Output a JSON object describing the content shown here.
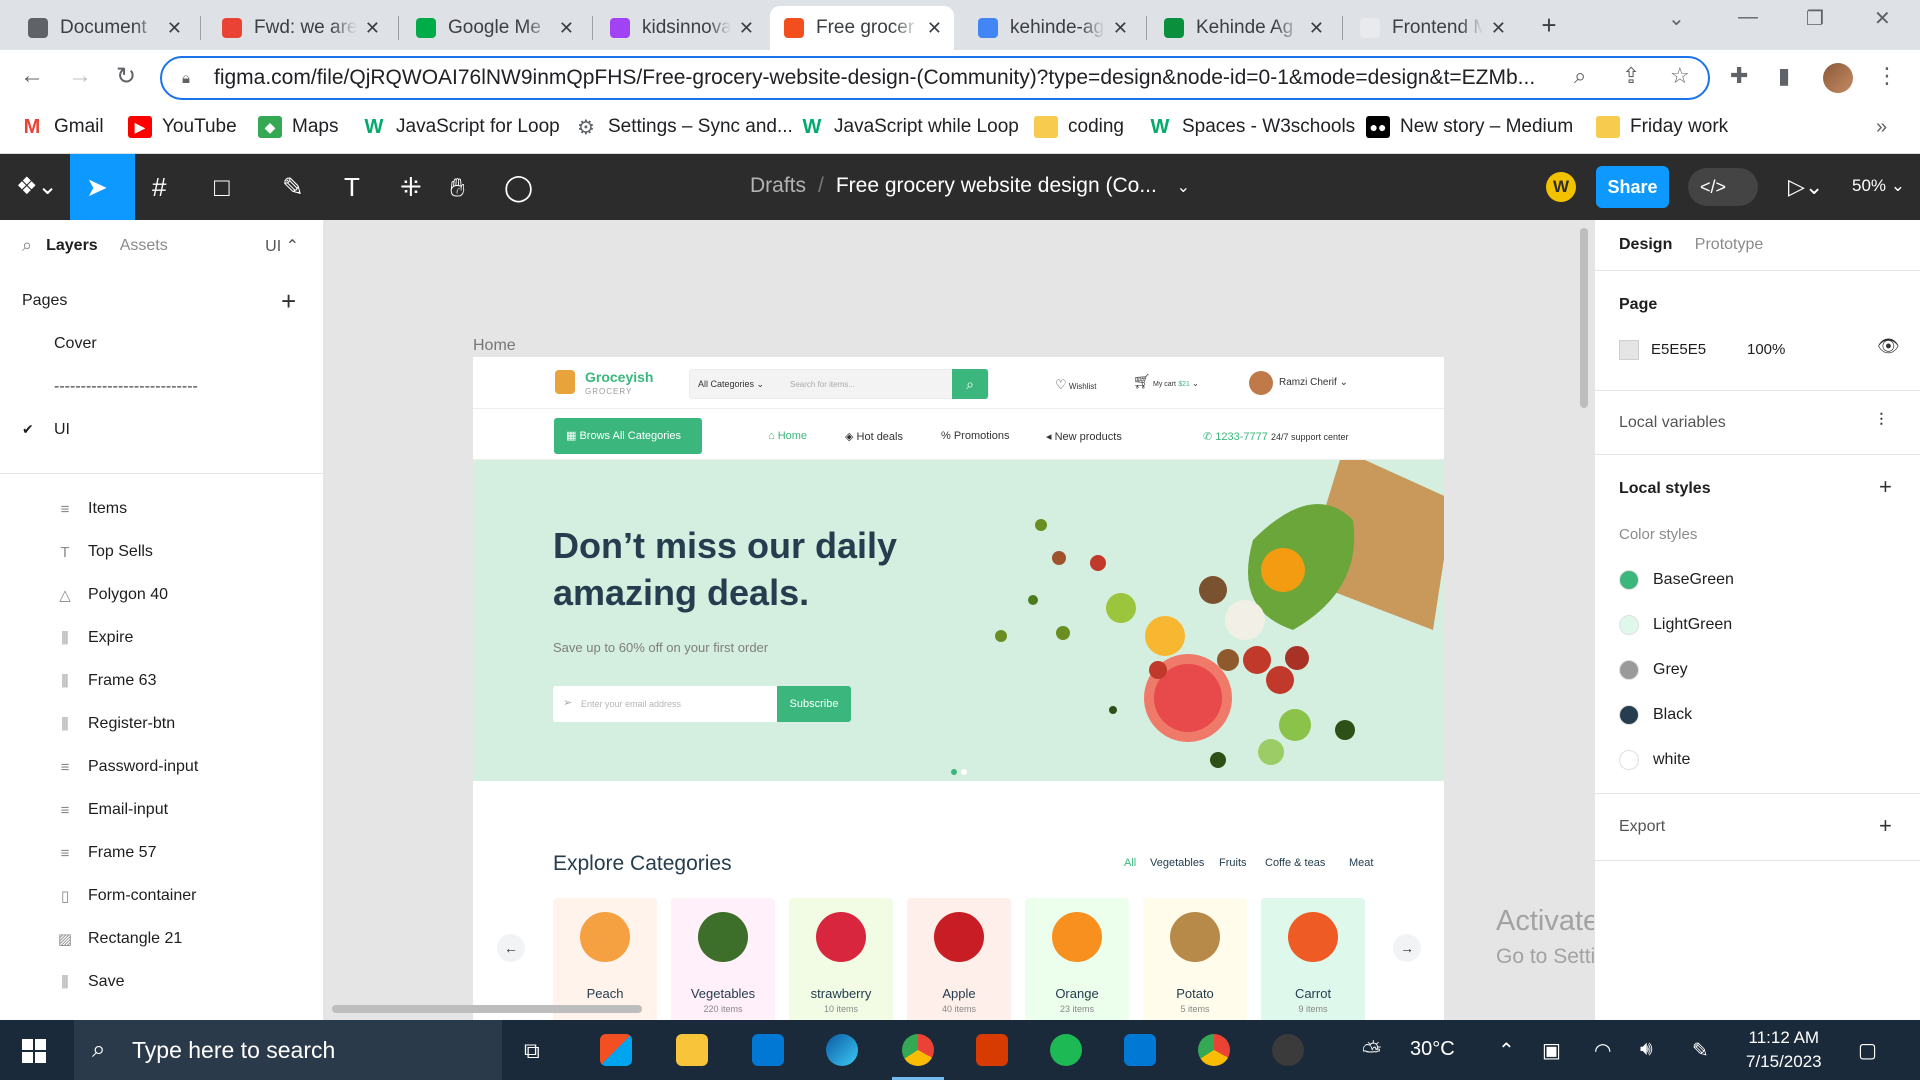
{
  "browser": {
    "tabs": [
      {
        "title": "Document",
        "color": "#5f6368"
      },
      {
        "title": "Fwd: we are",
        "color": "#ea4335"
      },
      {
        "title": "Google Me",
        "color": "#00ac47"
      },
      {
        "title": "kidsinnovat",
        "color": "#a142f4"
      },
      {
        "title": "Free grocer",
        "color": "#f24e1e"
      },
      {
        "title": "kehinde-ag",
        "color": "#4285f4"
      },
      {
        "title": "Kehinde Ag",
        "color": "#0a8f3d"
      },
      {
        "title": "Frontend M",
        "color": "#e8eaed"
      }
    ],
    "url": "figma.com/file/QjRQWOAI76lNW9inmQpFHS/Free-grocery-website-design-(Community)?type=design&node-id=0-1&mode=design&t=EZMb...",
    "bookmarks": [
      "Gmail",
      "YouTube",
      "Maps",
      "JavaScript for Loop",
      "Settings – Sync and...",
      "JavaScript while Loop",
      "coding",
      "Spaces - W3schools",
      "New story – Medium",
      "Friday work"
    ]
  },
  "figma": {
    "breadcrumb_drafts": "Drafts",
    "breadcrumb_sep": "/",
    "file_name": "Free grocery website design (Co...",
    "user_initial": "W",
    "share_label": "Share",
    "zoom": "50%",
    "left": {
      "tab_layers": "Layers",
      "tab_assets": "Assets",
      "page_badge": "UI",
      "pages_heading": "Pages",
      "pages": [
        "Cover",
        "---------------------------",
        "UI"
      ],
      "check": "✔",
      "layers": [
        {
          "icon": "≡",
          "label": "Items"
        },
        {
          "icon": "T",
          "label": "Top Sells"
        },
        {
          "icon": "△",
          "label": "Polygon 40"
        },
        {
          "icon": "⫼",
          "label": "Expire"
        },
        {
          "icon": "⫼",
          "label": "Frame 63"
        },
        {
          "icon": "⫼",
          "label": "Register-btn"
        },
        {
          "icon": "≡",
          "label": "Password-input"
        },
        {
          "icon": "≡",
          "label": "Email-input"
        },
        {
          "icon": "≡",
          "label": "Frame 57"
        },
        {
          "icon": "▯",
          "label": "Form-container"
        },
        {
          "icon": "▨",
          "label": "Rectangle 21"
        },
        {
          "icon": "⫼",
          "label": "Save"
        }
      ]
    },
    "canvas": {
      "frame_label": "Home",
      "site": {
        "logo_name": "Groceyish",
        "logo_sub": "GROCERY",
        "all_categories": "All Categories ⌄",
        "search_placeholder": "Search for items...",
        "wishlist": "Wishlist",
        "cart": "My cart",
        "cart_amount": "$21",
        "user": "Ramzi Cherif ⌄",
        "browse": "Brows All Categories",
        "nav": [
          "Home",
          "Hot deals",
          "Promotions",
          "New products"
        ],
        "phone": "1233-7777",
        "support": "24/7 support center",
        "hero_title": "Don’t miss our daily amazing deals.",
        "hero_sub": "Save up to 60% off on your first order",
        "email_placeholder": "Enter your email address",
        "subscribe": "Subscribe",
        "categories_heading": "Explore Categories",
        "filters": [
          "All",
          "Vegetables",
          "Fruits",
          "Coffe & teas",
          "Meat"
        ],
        "categories": [
          {
            "name": "Peach",
            "count": "20 items",
            "bg": "#fff3eb",
            "fruit": "#f5a041"
          },
          {
            "name": "Vegetables",
            "count": "220 items",
            "bg": "#fff0fa",
            "fruit": "#3d6e2a"
          },
          {
            "name": "strawberry",
            "count": "10 items",
            "bg": "#f2fce4",
            "fruit": "#d7263d"
          },
          {
            "name": "Apple",
            "count": "40 items",
            "bg": "#feefea",
            "fruit": "#c81d25"
          },
          {
            "name": "Orange",
            "count": "23 items",
            "bg": "#ecffec",
            "fruit": "#f7901e"
          },
          {
            "name": "Potato",
            "count": "5 items",
            "bg": "#fffceb",
            "fruit": "#b88a4a"
          },
          {
            "name": "Carrot",
            "count": "9 items",
            "bg": "#def9ec",
            "fruit": "#ef5b25"
          }
        ]
      }
    },
    "right": {
      "tab_design": "Design",
      "tab_prototype": "Prototype",
      "page_heading": "Page",
      "page_color": "E5E5E5",
      "page_opacity": "100%",
      "local_variables": "Local variables",
      "local_styles": "Local styles",
      "color_styles": "Color styles",
      "styles": [
        {
          "name": "BaseGreen",
          "color": "#3bb77e"
        },
        {
          "name": "LightGreen",
          "color": "#def9ec"
        },
        {
          "name": "Grey",
          "color": "#9a9a9a"
        },
        {
          "name": "Black",
          "color": "#253d4e"
        },
        {
          "name": "white",
          "color": "#ffffff"
        }
      ],
      "export": "Export"
    }
  },
  "watermark": {
    "line1": "Activate Windows",
    "line2": "Go to Settings to activate Windows."
  },
  "taskbar": {
    "search_placeholder": "Type here to search",
    "temperature": "30°C",
    "time": "11:12 AM",
    "date": "7/15/2023"
  }
}
